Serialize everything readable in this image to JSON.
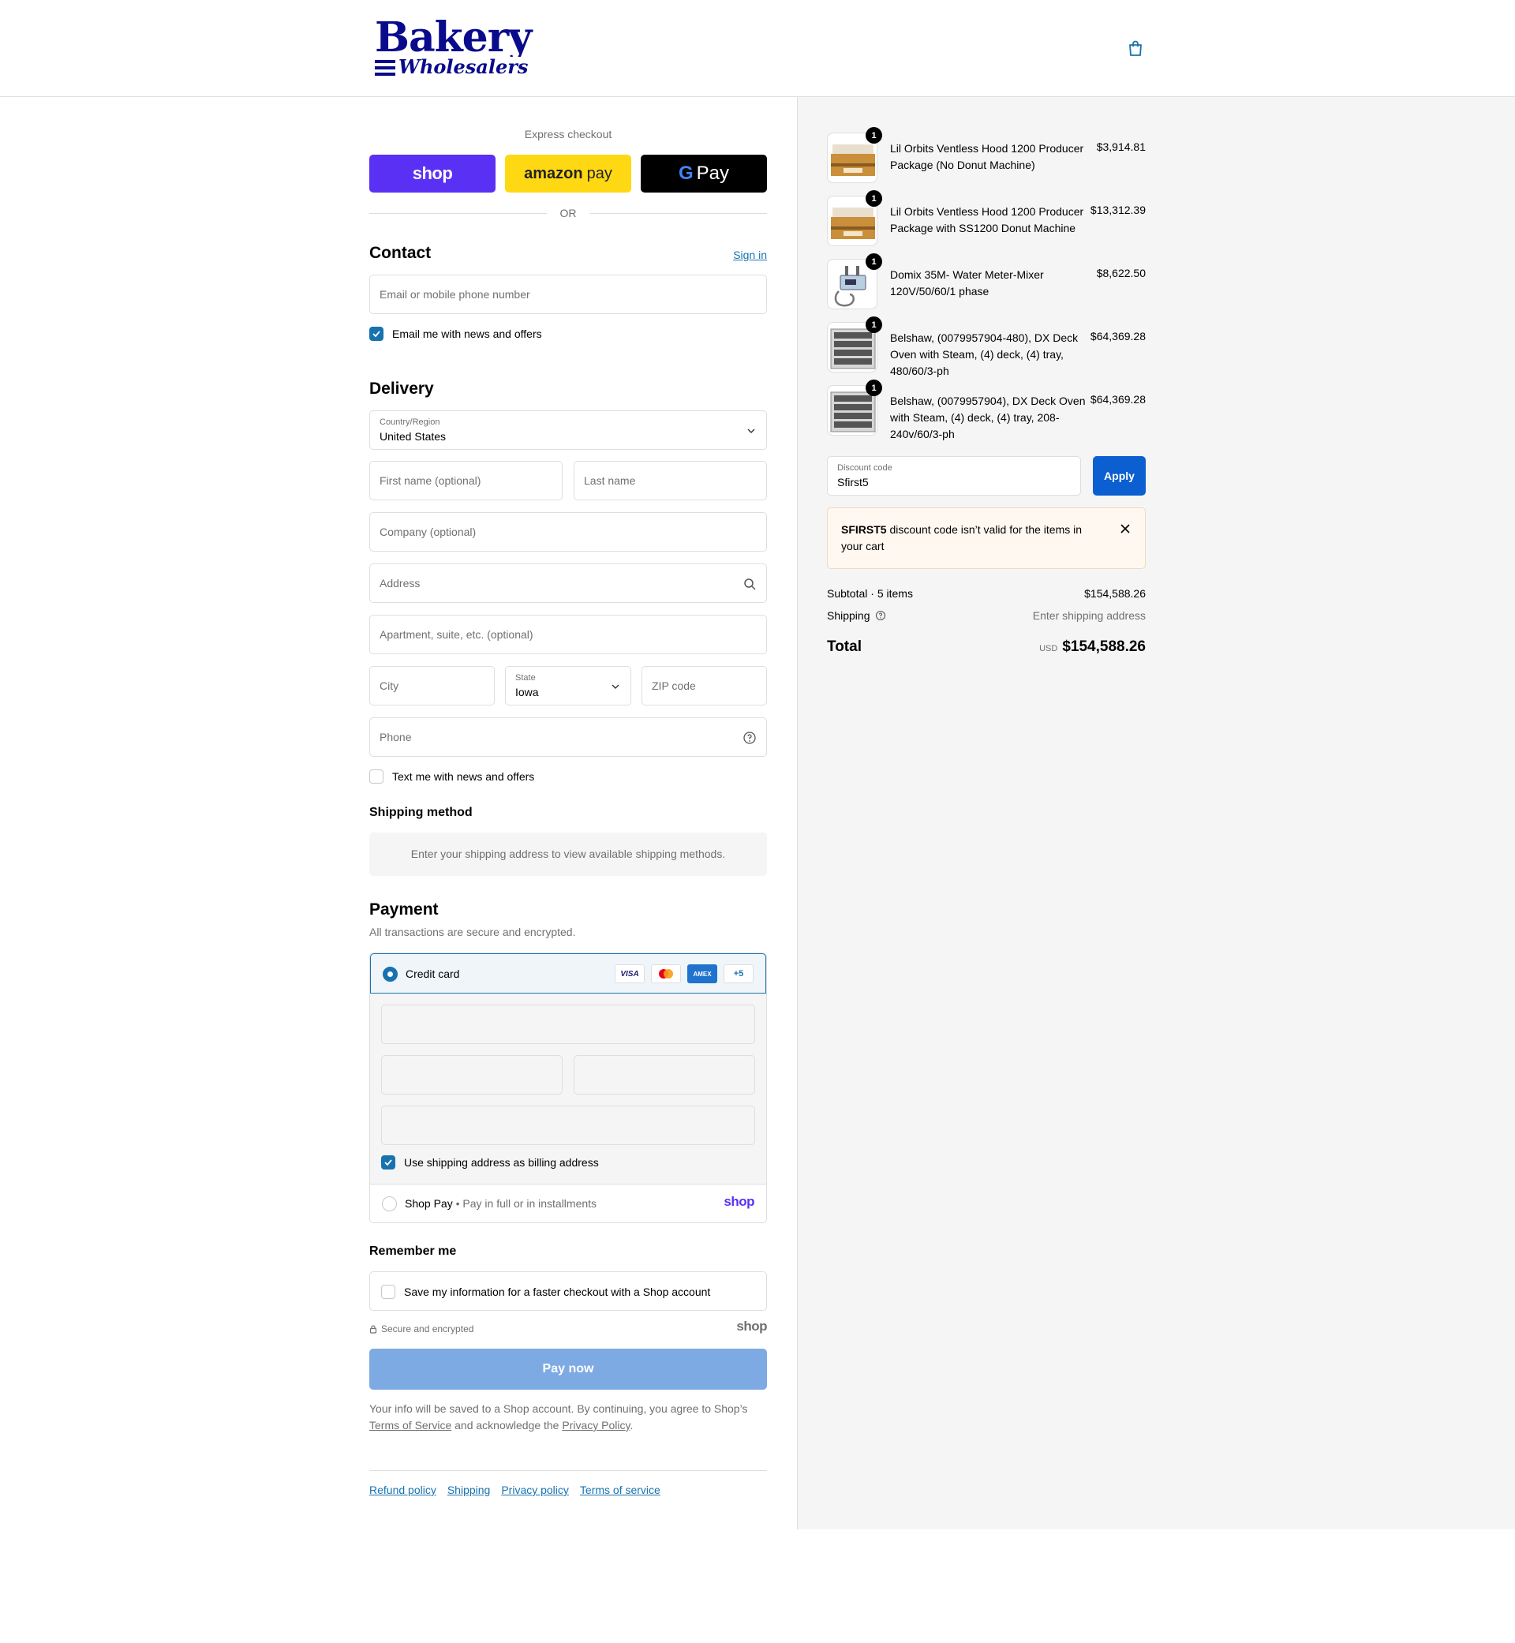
{
  "header": {
    "logo_top": "Bakery",
    "logo_bottom": "Wholesalers",
    "cart_icon": "shopping-bag-icon"
  },
  "express": {
    "title": "Express checkout",
    "shop_label": "shop",
    "amazon_bold": "amazon",
    "amazon_rest": "pay",
    "gpay_g": "G",
    "gpay_label": "Pay",
    "or_label": "OR"
  },
  "contact": {
    "title": "Contact",
    "sign_in": "Sign in",
    "email_placeholder": "Email or mobile phone number",
    "news_label": "Email me with news and offers",
    "news_checked": true
  },
  "delivery": {
    "title": "Delivery",
    "country_label": "Country/Region",
    "country_value": "United States",
    "first_name_placeholder": "First name (optional)",
    "last_name_placeholder": "Last name",
    "company_placeholder": "Company (optional)",
    "address_placeholder": "Address",
    "apartment_placeholder": "Apartment, suite, etc. (optional)",
    "city_placeholder": "City",
    "state_label": "State",
    "state_value": "Iowa",
    "zip_placeholder": "ZIP code",
    "phone_placeholder": "Phone",
    "text_label": "Text me with news and offers",
    "text_checked": false
  },
  "shipping_method": {
    "title": "Shipping method",
    "info": "Enter your shipping address to view available shipping methods."
  },
  "payment": {
    "title": "Payment",
    "subtitle": "All transactions are secure and encrypted.",
    "credit_card_label": "Credit card",
    "card_icons": [
      "VISA",
      "mastercard",
      "AMEX",
      "+5"
    ],
    "billing_label": "Use shipping address as billing address",
    "billing_checked": true,
    "shop_pay_label": "Shop Pay",
    "shop_pay_sub": "Pay in full or in installments",
    "shop_pay_logo": "shop"
  },
  "remember": {
    "title": "Remember me",
    "save_label": "Save my information for a faster checkout with a Shop account",
    "secure_label": "Secure and encrypted",
    "shop_logo": "shop"
  },
  "pay_now": "Pay now",
  "legal": {
    "p1": "Your info will be saved to a Shop account. By continuing, you agree to Shop’s",
    "terms": "Terms of Service",
    "p2": "and acknowledge the",
    "privacy": "Privacy Policy",
    "p3": "."
  },
  "footer": {
    "links": [
      "Refund policy",
      "Shipping",
      "Privacy policy",
      "Terms of service"
    ]
  },
  "order": {
    "items": [
      {
        "name": "Lil Orbits Ventless Hood 1200 Producer Package (No Donut Machine)",
        "price": "$3,914.81",
        "qty": "1",
        "thumb": "donut-machine-image"
      },
      {
        "name": "Lil Orbits Ventless Hood 1200 Producer Package with SS1200 Donut Machine",
        "price": "$13,312.39",
        "qty": "1",
        "thumb": "donut-machine-image"
      },
      {
        "name": "Domix 35M- Water Meter-Mixer 120V/50/60/1 phase",
        "price": "$8,622.50",
        "qty": "1",
        "thumb": "water-meter-image"
      },
      {
        "name": "Belshaw, (0079957904-480), DX Deck Oven with Steam, (4) deck, (4) tray, 480/60/3-ph",
        "price": "$64,369.28",
        "qty": "1",
        "thumb": "deck-oven-image"
      },
      {
        "name": "Belshaw, (0079957904), DX Deck Oven with Steam, (4) deck, (4) tray, 208-240v/60/3-ph",
        "price": "$64,369.28",
        "qty": "1",
        "thumb": "deck-oven-image"
      }
    ],
    "discount_label": "Discount code",
    "discount_value": "Sfirst5",
    "apply_label": "Apply",
    "alert_code": "SFIRST5",
    "alert_msg": "discount code isn’t valid for the items in your cart",
    "subtotal_label": "Subtotal · 5 items",
    "subtotal_value": "$154,588.26",
    "shipping_label": "Shipping",
    "shipping_value": "Enter shipping address",
    "total_label": "Total",
    "currency": "USD",
    "total_value": "$154,588.26"
  },
  "colors": {
    "accent": "#1773b0",
    "shop_purple": "#5a31f4",
    "amazon_yellow": "#ffd814",
    "apply_blue": "#0b5fd0",
    "pay_now_disabled": "#7eaae4"
  }
}
